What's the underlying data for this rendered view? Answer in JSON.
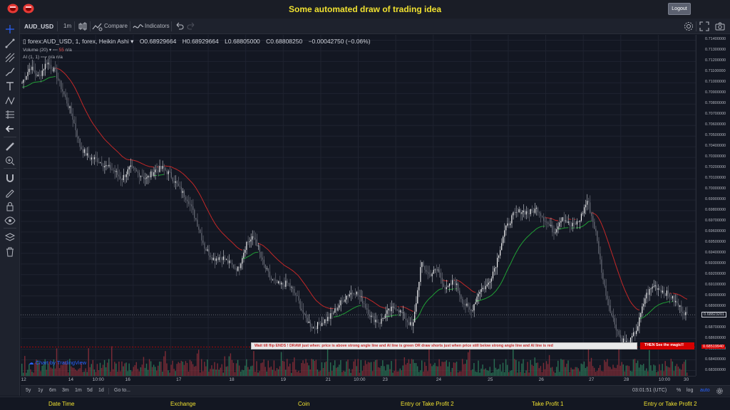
{
  "app": {
    "title": "Some automated draw of trading idea",
    "logout_label": "Logout"
  },
  "toolbar": {
    "symbol": "AUD_USD",
    "interval": "1m",
    "compare_label": "Compare",
    "indicators_label": "Indicators"
  },
  "legend": {
    "title": "forex:AUD_USD, 1, forex, Heikin Ashi",
    "open": "O0.68929664",
    "high": "H0.68929664",
    "low": "L0.68805000",
    "close": "C0.68808250",
    "change": "−0.00042750 (−0.06%)",
    "volume_study": "Volume (20)",
    "volume_value": "55",
    "volume_na": "n/a",
    "ai_study": "AI (1, 1)",
    "ai_na1": "n/a",
    "ai_na2": "n/a"
  },
  "price_axis": {
    "labels": [
      "0.71400000",
      "0.71300000",
      "0.71200000",
      "0.71100000",
      "0.71000000",
      "0.70900000",
      "0.70800000",
      "0.70700000",
      "0.70600000",
      "0.70500000",
      "0.70400000",
      "0.70300000",
      "0.70200000",
      "0.70100000",
      "0.70000000",
      "0.69900000",
      "0.69800000",
      "0.69700000",
      "0.69600000",
      "0.69500000",
      "0.69400000",
      "0.69300000",
      "0.69200000",
      "0.69100000",
      "0.69000000",
      "0.68900000",
      "0.68800000",
      "0.68700000",
      "0.68600000",
      "0.68500000",
      "0.68400000",
      "0.68300000"
    ],
    "last_price": "0.68823201",
    "red_price": "0.68519940"
  },
  "time_axis": {
    "labels": [
      "12",
      "14",
      "10:00",
      "16",
      "17",
      "18",
      "19",
      "21",
      "10:00",
      "23",
      "24",
      "25",
      "26",
      "27",
      "28",
      "10:00",
      "30"
    ]
  },
  "banner": {
    "message": "Wait till flip ENDS  !    DRAW just when:  price is above strong angle line and AI line is green        OR         draw shorts just when price still below strong angle line and AI line is red",
    "magic": "THEN See the magic!!"
  },
  "watermark": "Chart by TradingView",
  "bottombar": {
    "ranges": [
      "5y",
      "1y",
      "6m",
      "3m",
      "1m",
      "5d",
      "1d"
    ],
    "goto": "Go to...",
    "clock": "03:01:51 (UTC)",
    "percent": "%",
    "log": "log",
    "auto": "auto"
  },
  "footer": {
    "items": [
      "Date Time",
      "Exchange",
      "Coin",
      "Entry or Take Profit 2",
      "Take Profit 1",
      "Entry or Take Profit 2"
    ]
  },
  "colors": {
    "background": "#131722",
    "up_candle": "#ffffff",
    "down_candle": "#6b6f7a",
    "ai_green": "#21a336",
    "ai_red": "#c62828",
    "title_yellow": "#f0e130",
    "volume_green": "#2e7d5b",
    "volume_red": "#8e2f3a"
  },
  "chart_data": {
    "type": "candlestick",
    "series_style": "Heikin Ashi",
    "ylim": [
      0.6825,
      0.7145
    ],
    "x": [
      "12",
      "13",
      "14",
      "15",
      "16",
      "17",
      "18",
      "19",
      "20",
      "21",
      "22",
      "23",
      "24",
      "25",
      "26",
      "27",
      "28",
      "29",
      "30"
    ],
    "close_path": [
      0.71,
      0.7115,
      0.7105,
      0.712,
      0.711,
      0.709,
      0.707,
      0.704,
      0.703,
      0.7028,
      0.7022,
      0.7018,
      0.701,
      0.702,
      0.7015,
      0.701,
      0.7018,
      0.702,
      0.7012,
      0.7,
      0.699,
      0.697,
      0.6945,
      0.6935,
      0.6937,
      0.693,
      0.6925,
      0.695,
      0.6955,
      0.693,
      0.6915,
      0.691,
      0.6912,
      0.69,
      0.688,
      0.687,
      0.6875,
      0.688,
      0.689,
      0.69,
      0.6905,
      0.6895,
      0.688,
      0.6875,
      0.6885,
      0.689,
      0.688,
      0.687,
      0.693,
      0.692,
      0.6925,
      0.6905,
      0.6915,
      0.6895,
      0.6885,
      0.6905,
      0.691,
      0.693,
      0.696,
      0.6975,
      0.698,
      0.6978,
      0.6982,
      0.697,
      0.696,
      0.6975,
      0.6965,
      0.697,
      0.699,
      0.696,
      0.691,
      0.688,
      0.686,
      0.6855,
      0.687,
      0.69,
      0.691,
      0.6905,
      0.69,
      0.689,
      0.6882
    ],
    "volume_note": "volume histogram beneath price"
  }
}
